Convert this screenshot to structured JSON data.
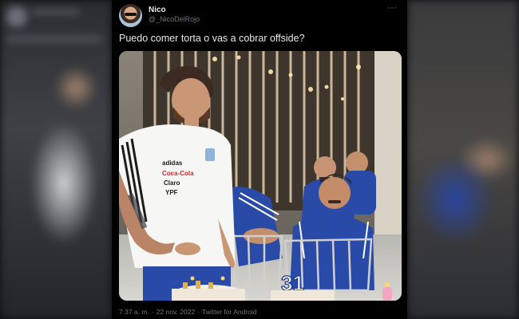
{
  "tweet": {
    "display_name": "Nico",
    "handle": "@_NicoDelRojo",
    "more_icon": "more-horizontal-icon",
    "text": "Puedo comer torta o vas a cobrar offside?",
    "time": "7:37 a. m.",
    "separator": "·",
    "date": "22 nov. 2022",
    "client": "Twitter for Android"
  },
  "media": {
    "shirt_sponsor_1": "Coca-Cola",
    "shirt_sponsor_2": "Claro",
    "shirt_sponsor_3": "YPF",
    "shirt_brand": "adidas",
    "cake_number": "31"
  },
  "colors": {
    "background": "#000000",
    "text_primary": "#e7e9ea",
    "text_secondary": "#71767b",
    "jersey_blue": "#2a4aa8"
  }
}
